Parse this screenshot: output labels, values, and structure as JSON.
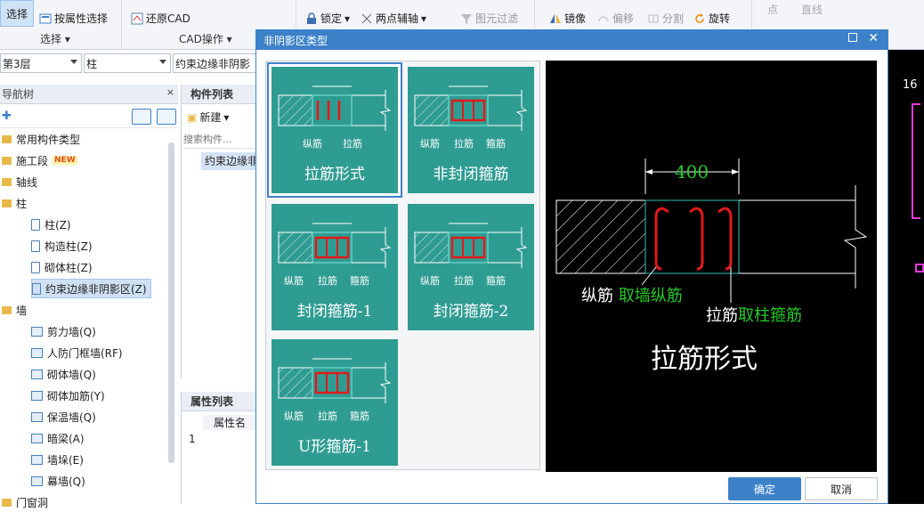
{
  "ribbon": {
    "select_label": "选择",
    "attr_select": "按属性选择",
    "group_select": "选择",
    "restore_cad": "还原CAD",
    "group_cad": "CAD操作",
    "lock": "锁定",
    "two_point_axis": "两点辅轴",
    "filter": "图元过滤",
    "mirror": "镜像",
    "offset": "偏移",
    "split": "分割",
    "rotate": "旋转",
    "point": "点",
    "line": "直线"
  },
  "combos": {
    "floor": "第3层",
    "type": "柱",
    "sub": "约束边缘非阴影"
  },
  "nav": {
    "title": "导航树",
    "items": [
      {
        "label": "常用构件类型",
        "level": 0,
        "kind": "folder"
      },
      {
        "label": "施工段",
        "level": 0,
        "kind": "folder",
        "badge": "NEW"
      },
      {
        "label": "轴线",
        "level": 0,
        "kind": "folder"
      },
      {
        "label": "柱",
        "level": 0,
        "kind": "folder"
      },
      {
        "label": "柱(Z)",
        "level": 1,
        "kind": "col"
      },
      {
        "label": "构造柱(Z)",
        "level": 1,
        "kind": "col"
      },
      {
        "label": "砌体柱(Z)",
        "level": 1,
        "kind": "col"
      },
      {
        "label": "约束边缘非阴影区(Z)",
        "level": 1,
        "kind": "col",
        "selected": true
      },
      {
        "label": "墙",
        "level": 0,
        "kind": "folder"
      },
      {
        "label": "剪力墙(Q)",
        "level": 1,
        "kind": "wall"
      },
      {
        "label": "人防门框墙(RF)",
        "level": 1,
        "kind": "wall"
      },
      {
        "label": "砌体墙(Q)",
        "level": 1,
        "kind": "wall"
      },
      {
        "label": "砌体加筋(Y)",
        "level": 1,
        "kind": "wall"
      },
      {
        "label": "保温墙(Q)",
        "level": 1,
        "kind": "wall"
      },
      {
        "label": "暗梁(A)",
        "level": 1,
        "kind": "wall"
      },
      {
        "label": "墙垛(E)",
        "level": 1,
        "kind": "wall"
      },
      {
        "label": "幕墙(Q)",
        "level": 1,
        "kind": "wall"
      },
      {
        "label": "门窗洞",
        "level": 0,
        "kind": "folder"
      }
    ]
  },
  "component_list": {
    "tab": "构件列表",
    "new_btn": "新建",
    "search_placeholder": "搜索构件...",
    "item": "约束边缘非"
  },
  "property_list": {
    "tab": "属性列表",
    "col_name": "属性名",
    "row1": "1"
  },
  "dialog": {
    "title": "非阴影区类型",
    "tiles": [
      {
        "name": "拉筋形式",
        "labels": [
          "纵筋",
          "拉筋"
        ],
        "selected": true
      },
      {
        "name": "非封闭箍筋",
        "labels": [
          "纵筋",
          "拉筋",
          "箍筋"
        ]
      },
      {
        "name": "封闭箍筋-1",
        "labels": [
          "纵筋",
          "拉筋",
          "箍筋"
        ]
      },
      {
        "name": "封闭箍筋-2",
        "labels": [
          "纵筋",
          "拉筋",
          "箍筋"
        ]
      },
      {
        "name": "U形箍筋-1",
        "labels": [
          "纵筋",
          "拉筋",
          "箍筋"
        ]
      }
    ],
    "preview": {
      "dimension": "400",
      "label1_white": "纵筋",
      "label1_green": "取墙纵筋",
      "label2_white": "拉筋",
      "label2_green": "取柱箍筋",
      "title": "拉筋形式"
    },
    "ok": "确定",
    "cancel": "取消"
  },
  "canvas": {
    "corner_text": "16"
  },
  "colors": {
    "accent": "#3d82c9",
    "tile": "#2f9c92",
    "rebar": "#e11a1a",
    "preview_green": "#26c92a"
  }
}
